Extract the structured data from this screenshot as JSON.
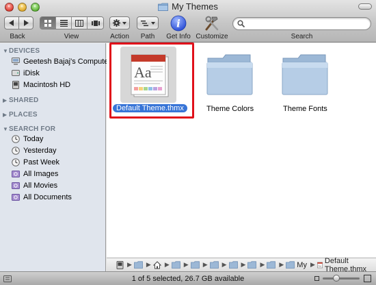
{
  "window": {
    "title": "My Themes"
  },
  "toolbar": {
    "back_label": "Back",
    "view_label": "View",
    "action_label": "Action",
    "path_label": "Path",
    "getinfo_label": "Get Info",
    "customize_label": "Customize",
    "search_label": "Search",
    "search_value": "",
    "active_view": "icon",
    "accent_color": "#3875d7"
  },
  "sidebar": {
    "sections": [
      {
        "title": "DEVICES",
        "expanded": true
      },
      {
        "title": "SHARED",
        "expanded": false
      },
      {
        "title": "PLACES",
        "expanded": false
      },
      {
        "title": "SEARCH FOR",
        "expanded": true
      }
    ],
    "devices": [
      {
        "label": "Geetesh Bajaj's Computer",
        "icon": "computer-icon"
      },
      {
        "label": "iDisk",
        "icon": "idisk-icon"
      },
      {
        "label": "Macintosh HD",
        "icon": "harddisk-icon"
      }
    ],
    "search_for": [
      {
        "label": "Today",
        "icon": "clock-icon"
      },
      {
        "label": "Yesterday",
        "icon": "clock-icon"
      },
      {
        "label": "Past Week",
        "icon": "clock-icon"
      },
      {
        "label": "All Images",
        "icon": "smart-folder-icon"
      },
      {
        "label": "All Movies",
        "icon": "smart-folder-icon"
      },
      {
        "label": "All Documents",
        "icon": "smart-folder-icon"
      }
    ]
  },
  "files": [
    {
      "name": "Default Theme.thmx",
      "selected": true,
      "icon": "theme-file-icon"
    },
    {
      "name": "Theme Colors",
      "selected": false,
      "icon": "folder-icon"
    },
    {
      "name": "Theme Fonts",
      "selected": false,
      "icon": "folder-icon"
    }
  ],
  "pathbar": {
    "segments": [
      {
        "label": "",
        "icon": "harddisk-icon"
      },
      {
        "label": "",
        "icon": "folder-icon"
      },
      {
        "label": "",
        "icon": "home-icon"
      },
      {
        "label": "",
        "icon": "folder-icon"
      },
      {
        "label": "",
        "icon": "folder-icon"
      },
      {
        "label": "",
        "icon": "folder-icon"
      },
      {
        "label": "",
        "icon": "folder-icon"
      },
      {
        "label": "",
        "icon": "folder-icon"
      },
      {
        "label": "",
        "icon": "folder-icon"
      },
      {
        "label": "My",
        "icon": "folder-icon"
      },
      {
        "label": "Default Theme.thmx",
        "icon": "theme-file-icon"
      }
    ]
  },
  "status": {
    "text": "1 of 5 selected, 26.7 GB available",
    "icon_size_fraction": 0.35
  }
}
